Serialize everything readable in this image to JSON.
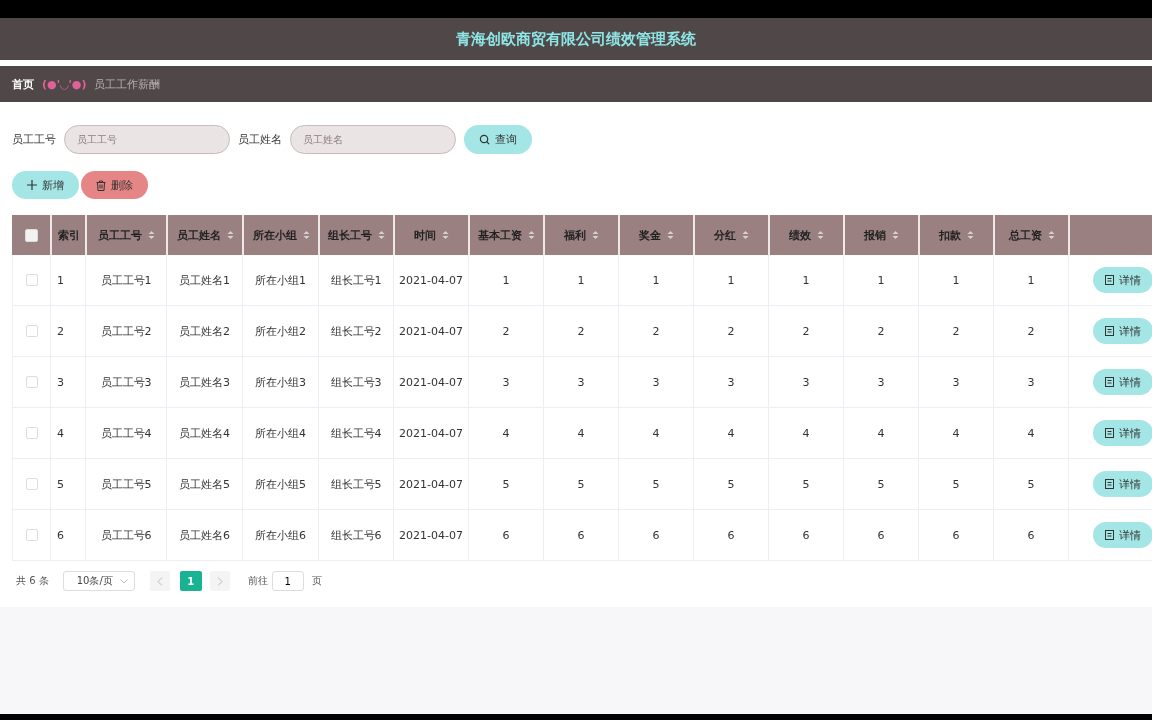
{
  "header": {
    "title": "青海创欧商贸有限公司绩效管理系统"
  },
  "breadcrumb": {
    "home": "首页",
    "separator": "(●'◡'●)",
    "current": "员工工作薪酬"
  },
  "search": {
    "fields": [
      {
        "label": "员工工号",
        "placeholder": "员工工号"
      },
      {
        "label": "员工姓名",
        "placeholder": "员工姓名"
      }
    ],
    "button": "查询"
  },
  "actions": [
    {
      "kind": "add",
      "label": "新增"
    },
    {
      "kind": "delete",
      "label": "删除"
    }
  ],
  "table": {
    "all_checked": false,
    "columns": [
      {
        "label": "索引",
        "sortable": false
      },
      {
        "label": "员工工号",
        "sortable": true
      },
      {
        "label": "员工姓名",
        "sortable": true
      },
      {
        "label": "所在小组",
        "sortable": true
      },
      {
        "label": "组长工号",
        "sortable": true
      },
      {
        "label": "时间",
        "sortable": true
      },
      {
        "label": "基本工资",
        "sortable": true
      },
      {
        "label": "福利",
        "sortable": true
      },
      {
        "label": "奖金",
        "sortable": true
      },
      {
        "label": "分红",
        "sortable": true
      },
      {
        "label": "绩效",
        "sortable": true
      },
      {
        "label": "报销",
        "sortable": true
      },
      {
        "label": "扣款",
        "sortable": true
      },
      {
        "label": "总工资",
        "sortable": true
      }
    ],
    "rows": [
      {
        "checked": false,
        "cells": [
          "1",
          "员工工号1",
          "员工姓名1",
          "所在小组1",
          "组长工号1",
          "2021-04-07",
          "1",
          "1",
          "1",
          "1",
          "1",
          "1",
          "1",
          "1"
        ],
        "action": "详情"
      },
      {
        "checked": false,
        "cells": [
          "2",
          "员工工号2",
          "员工姓名2",
          "所在小组2",
          "组长工号2",
          "2021-04-07",
          "2",
          "2",
          "2",
          "2",
          "2",
          "2",
          "2",
          "2"
        ],
        "action": "详情"
      },
      {
        "checked": false,
        "cells": [
          "3",
          "员工工号3",
          "员工姓名3",
          "所在小组3",
          "组长工号3",
          "2021-04-07",
          "3",
          "3",
          "3",
          "3",
          "3",
          "3",
          "3",
          "3"
        ],
        "action": "详情"
      },
      {
        "checked": false,
        "cells": [
          "4",
          "员工工号4",
          "员工姓名4",
          "所在小组4",
          "组长工号4",
          "2021-04-07",
          "4",
          "4",
          "4",
          "4",
          "4",
          "4",
          "4",
          "4"
        ],
        "action": "详情"
      },
      {
        "checked": false,
        "cells": [
          "5",
          "员工工号5",
          "员工姓名5",
          "所在小组5",
          "组长工号5",
          "2021-04-07",
          "5",
          "5",
          "5",
          "5",
          "5",
          "5",
          "5",
          "5"
        ],
        "action": "详情"
      },
      {
        "checked": false,
        "cells": [
          "6",
          "员工工号6",
          "员工姓名6",
          "所在小组6",
          "组长工号6",
          "2021-04-07",
          "6",
          "6",
          "6",
          "6",
          "6",
          "6",
          "6",
          "6"
        ],
        "action": "详情"
      }
    ]
  },
  "pagination": {
    "total": "共 6 条",
    "page_size": "10条/页",
    "pages": [
      {
        "label": "1",
        "selected": true
      }
    ],
    "goto_label": "前往",
    "goto_value": "1",
    "goto_suffix": "页"
  }
}
